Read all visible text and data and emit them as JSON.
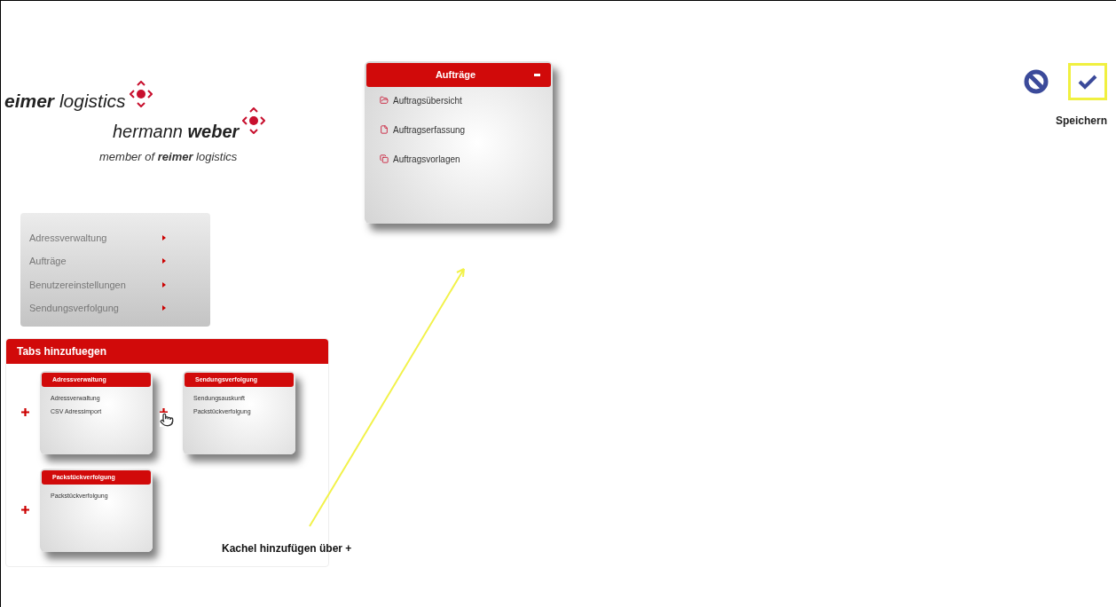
{
  "logo": {
    "brand": "**eimer** logistics",
    "subbrand": "hermann **weber**",
    "tagline": "member of **reimer** logistics"
  },
  "menu": {
    "items": [
      {
        "label": "Adressverwaltung"
      },
      {
        "label": "Aufträge"
      },
      {
        "label": "Benutzereinstellungen"
      },
      {
        "label": "Sendungsverfolgung"
      }
    ]
  },
  "tabs_panel": {
    "title": "Tabs hinzufuegen",
    "tiles": [
      {
        "title": "Adressverwaltung",
        "items": [
          "Adressverwaltung",
          "CSV Adressimport"
        ]
      },
      {
        "title": "Sendungsverfolgung",
        "items": [
          "Sendungsauskunft",
          "Packstückverfolgung"
        ]
      },
      {
        "title": "Packstückverfolgung",
        "items": [
          "Packstückverfolgung"
        ]
      }
    ],
    "annotation": "Kachel hinzufügen über +"
  },
  "orders_tile": {
    "title": "Aufträge",
    "items": [
      {
        "label": "Auftragsübersicht",
        "kind": "folder"
      },
      {
        "label": "Auftragserfassung",
        "kind": "file"
      },
      {
        "label": "Auftragsvorlagen",
        "kind": "copy"
      }
    ]
  },
  "toolbar": {
    "save_label": "Speichern",
    "save_highlighted": true
  }
}
